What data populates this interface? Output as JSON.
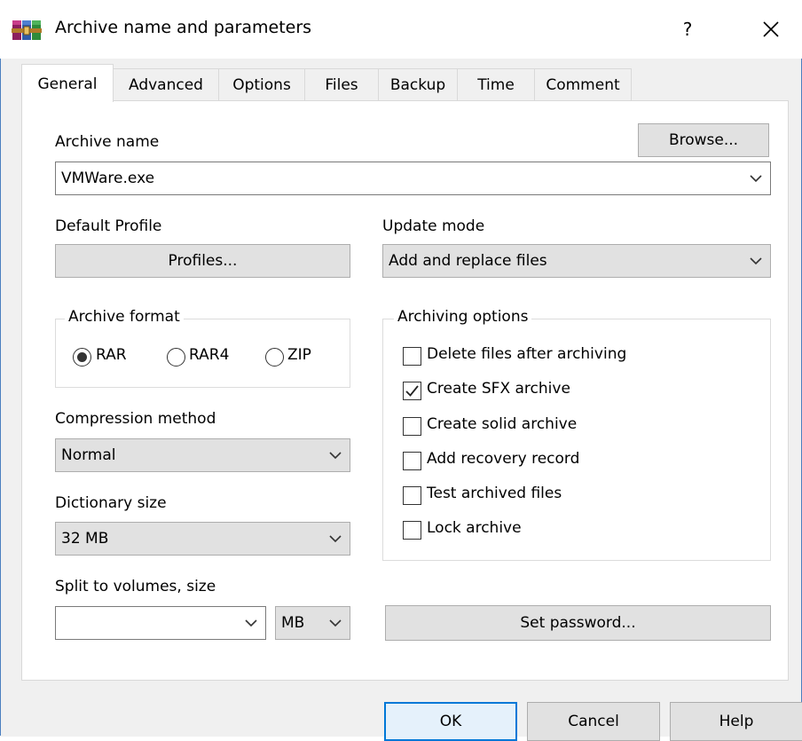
{
  "window": {
    "title": "Archive name and parameters",
    "help_label": "?",
    "close_label": "✕"
  },
  "tabs": [
    {
      "label": "General",
      "active": true
    },
    {
      "label": "Advanced"
    },
    {
      "label": "Options"
    },
    {
      "label": "Files"
    },
    {
      "label": "Backup"
    },
    {
      "label": "Time"
    },
    {
      "label": "Comment"
    }
  ],
  "archive_name": {
    "label": "Archive name",
    "value": "VMWare.exe",
    "browse_label": "Browse..."
  },
  "profile": {
    "label": "Default Profile",
    "button_label": "Profiles..."
  },
  "update_mode": {
    "label": "Update mode",
    "value": "Add and replace files"
  },
  "archive_format": {
    "label": "Archive format",
    "options": [
      {
        "label": "RAR",
        "selected": true
      },
      {
        "label": "RAR4",
        "selected": false
      },
      {
        "label": "ZIP",
        "selected": false
      }
    ]
  },
  "compression": {
    "label": "Compression method",
    "value": "Normal"
  },
  "dictionary": {
    "label": "Dictionary size",
    "value": "32 MB"
  },
  "split": {
    "label": "Split to volumes, size",
    "value": "",
    "unit": "MB"
  },
  "archiving_options": {
    "label": "Archiving options",
    "items": [
      {
        "label": "Delete files after archiving",
        "checked": false
      },
      {
        "label": "Create SFX archive",
        "checked": true
      },
      {
        "label": "Create solid archive",
        "checked": false
      },
      {
        "label": "Add recovery record",
        "checked": false
      },
      {
        "label": "Test archived files",
        "checked": false
      },
      {
        "label": "Lock archive",
        "checked": false
      }
    ]
  },
  "set_password_label": "Set password...",
  "footer": {
    "ok_label": "OK",
    "cancel_label": "Cancel",
    "help_label": "Help"
  },
  "colors": {
    "accent": "#0078d7",
    "panel": "#ffffff",
    "face": "#f0f0f0",
    "button": "#e1e1e1"
  }
}
